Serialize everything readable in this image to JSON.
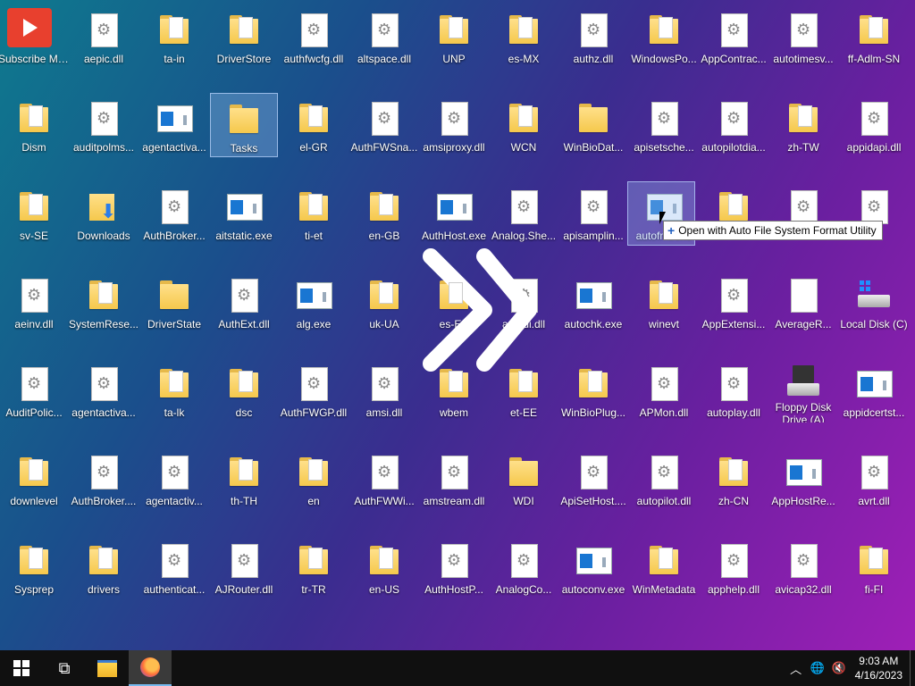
{
  "desktop": {
    "icons": [
      {
        "label": "Subscribe My Youtube Ch...",
        "type": "yt",
        "col": 0,
        "row": 0
      },
      {
        "label": "aepic.dll",
        "type": "file",
        "col": 1,
        "row": 0
      },
      {
        "label": "ta-in",
        "type": "folder docs",
        "col": 2,
        "row": 0
      },
      {
        "label": "DriverStore",
        "type": "folder docs",
        "col": 3,
        "row": 0
      },
      {
        "label": "authfwcfg.dll",
        "type": "file",
        "col": 4,
        "row": 0
      },
      {
        "label": "altspace.dll",
        "type": "file",
        "col": 5,
        "row": 0
      },
      {
        "label": "UNP",
        "type": "folder docs",
        "col": 6,
        "row": 0
      },
      {
        "label": "es-MX",
        "type": "folder docs",
        "col": 7,
        "row": 0
      },
      {
        "label": "authz.dll",
        "type": "file",
        "col": 8,
        "row": 0
      },
      {
        "label": "WindowsPo...",
        "type": "folder docs",
        "col": 9,
        "row": 0
      },
      {
        "label": "AppContrac...",
        "type": "file",
        "col": 10,
        "row": 0
      },
      {
        "label": "autotimesv...",
        "type": "file",
        "col": 11,
        "row": 0
      },
      {
        "label": "ff-Adlm-SN",
        "type": "folder docs",
        "col": 12,
        "row": 0
      },
      {
        "label": "Dism",
        "type": "folder docs",
        "col": 0,
        "row": 1
      },
      {
        "label": "auditpolms...",
        "type": "file",
        "col": 1,
        "row": 1
      },
      {
        "label": "agentactiva...",
        "type": "exe",
        "col": 2,
        "row": 1
      },
      {
        "label": "Tasks",
        "type": "folder",
        "col": 3,
        "row": 1,
        "selected": true
      },
      {
        "label": "el-GR",
        "type": "folder docs",
        "col": 4,
        "row": 1
      },
      {
        "label": "AuthFWSna...",
        "type": "file",
        "col": 5,
        "row": 1
      },
      {
        "label": "amsiproxy.dll",
        "type": "file",
        "col": 6,
        "row": 1
      },
      {
        "label": "WCN",
        "type": "folder docs",
        "col": 7,
        "row": 1
      },
      {
        "label": "WinBioDat...",
        "type": "folder",
        "col": 8,
        "row": 1
      },
      {
        "label": "apisetsche...",
        "type": "file",
        "col": 9,
        "row": 1
      },
      {
        "label": "autopilotdia...",
        "type": "file",
        "col": 10,
        "row": 1
      },
      {
        "label": "zh-TW",
        "type": "folder docs",
        "col": 11,
        "row": 1
      },
      {
        "label": "appidapi.dll",
        "type": "file",
        "col": 12,
        "row": 1
      },
      {
        "label": "sv-SE",
        "type": "folder docs",
        "col": 0,
        "row": 2
      },
      {
        "label": "Downloads",
        "type": "dl",
        "col": 1,
        "row": 2
      },
      {
        "label": "AuthBroker...",
        "type": "file",
        "col": 2,
        "row": 2
      },
      {
        "label": "aitstatic.exe",
        "type": "exe",
        "col": 3,
        "row": 2
      },
      {
        "label": "ti-et",
        "type": "folder docs",
        "col": 4,
        "row": 2
      },
      {
        "label": "en-GB",
        "type": "folder docs",
        "col": 5,
        "row": 2
      },
      {
        "label": "AuthHost.exe",
        "type": "exe",
        "col": 6,
        "row": 2
      },
      {
        "label": "Analog.She...",
        "type": "file",
        "col": 7,
        "row": 2
      },
      {
        "label": "apisamplin...",
        "type": "file",
        "col": 8,
        "row": 2
      },
      {
        "label": "autofmt.exe",
        "type": "exe",
        "col": 9,
        "row": 2
      },
      {
        "label": "",
        "type": "folder docs",
        "col": 10,
        "row": 2
      },
      {
        "label": "",
        "type": "file",
        "col": 11,
        "row": 2
      },
      {
        "label": "",
        "type": "file",
        "col": 12,
        "row": 2
      },
      {
        "label": "aeinv.dll",
        "type": "file",
        "col": 0,
        "row": 3
      },
      {
        "label": "SystemRese...",
        "type": "folder docs",
        "col": 1,
        "row": 3
      },
      {
        "label": "DriverState",
        "type": "folder",
        "col": 2,
        "row": 3
      },
      {
        "label": "AuthExt.dll",
        "type": "file",
        "col": 3,
        "row": 3
      },
      {
        "label": "alg.exe",
        "type": "exe",
        "col": 4,
        "row": 3
      },
      {
        "label": "uk-UA",
        "type": "folder docs",
        "col": 5,
        "row": 3
      },
      {
        "label": "es-ES",
        "type": "folder docs",
        "col": 6,
        "row": 3
      },
      {
        "label": "authui.dll",
        "type": "file",
        "col": 7,
        "row": 3
      },
      {
        "label": "autochk.exe",
        "type": "exe",
        "col": 8,
        "row": 3
      },
      {
        "label": "winevt",
        "type": "folder docs",
        "col": 9,
        "row": 3
      },
      {
        "label": "AppExtensi...",
        "type": "file",
        "col": 10,
        "row": 3
      },
      {
        "label": "AverageR...",
        "type": "file blank",
        "col": 11,
        "row": 3
      },
      {
        "label": "Local Disk (C)",
        "type": "disk",
        "col": 12,
        "row": 3
      },
      {
        "label": "AuditPolic...",
        "type": "file",
        "col": 0,
        "row": 4
      },
      {
        "label": "agentactiva...",
        "type": "file",
        "col": 1,
        "row": 4
      },
      {
        "label": "ta-lk",
        "type": "folder docs",
        "col": 2,
        "row": 4
      },
      {
        "label": "dsc",
        "type": "folder docs",
        "col": 3,
        "row": 4
      },
      {
        "label": "AuthFWGP.dll",
        "type": "file",
        "col": 4,
        "row": 4
      },
      {
        "label": "amsi.dll",
        "type": "file",
        "col": 5,
        "row": 4
      },
      {
        "label": "wbem",
        "type": "folder docs",
        "col": 6,
        "row": 4
      },
      {
        "label": "et-EE",
        "type": "folder docs",
        "col": 7,
        "row": 4
      },
      {
        "label": "WinBioPlug...",
        "type": "folder docs",
        "col": 8,
        "row": 4
      },
      {
        "label": "APMon.dll",
        "type": "file",
        "col": 9,
        "row": 4
      },
      {
        "label": "autoplay.dll",
        "type": "file",
        "col": 10,
        "row": 4
      },
      {
        "label": "Floppy Disk Drive (A)",
        "type": "floppy",
        "col": 11,
        "row": 4,
        "wrap": true
      },
      {
        "label": "appidcertst...",
        "type": "exe",
        "col": 12,
        "row": 4
      },
      {
        "label": "downlevel",
        "type": "folder docs",
        "col": 0,
        "row": 5
      },
      {
        "label": "AuthBroker....",
        "type": "file",
        "col": 1,
        "row": 5
      },
      {
        "label": "agentactiv...",
        "type": "file",
        "col": 2,
        "row": 5
      },
      {
        "label": "th-TH",
        "type": "folder docs",
        "col": 3,
        "row": 5
      },
      {
        "label": "en",
        "type": "folder docs",
        "col": 4,
        "row": 5
      },
      {
        "label": "AuthFWWi...",
        "type": "file",
        "col": 5,
        "row": 5
      },
      {
        "label": "amstream.dll",
        "type": "file",
        "col": 6,
        "row": 5
      },
      {
        "label": "WDI",
        "type": "folder",
        "col": 7,
        "row": 5
      },
      {
        "label": "ApiSetHost....",
        "type": "file",
        "col": 8,
        "row": 5
      },
      {
        "label": "autopilot.dll",
        "type": "file",
        "col": 9,
        "row": 5
      },
      {
        "label": "zh-CN",
        "type": "folder docs",
        "col": 10,
        "row": 5
      },
      {
        "label": "AppHostRe...",
        "type": "exe",
        "col": 11,
        "row": 5
      },
      {
        "label": "avrt.dll",
        "type": "file",
        "col": 12,
        "row": 5
      },
      {
        "label": "Sysprep",
        "type": "folder docs",
        "col": 0,
        "row": 6
      },
      {
        "label": "drivers",
        "type": "folder docs",
        "col": 1,
        "row": 6
      },
      {
        "label": "authenticat...",
        "type": "file",
        "col": 2,
        "row": 6
      },
      {
        "label": "AJRouter.dll",
        "type": "file",
        "col": 3,
        "row": 6
      },
      {
        "label": "tr-TR",
        "type": "folder docs",
        "col": 4,
        "row": 6
      },
      {
        "label": "en-US",
        "type": "folder docs",
        "col": 5,
        "row": 6
      },
      {
        "label": "AuthHostP...",
        "type": "file",
        "col": 6,
        "row": 6
      },
      {
        "label": "AnalogCo...",
        "type": "file",
        "col": 7,
        "row": 6
      },
      {
        "label": "autoconv.exe",
        "type": "exe",
        "col": 8,
        "row": 6
      },
      {
        "label": "WinMetadata",
        "type": "folder docs",
        "col": 9,
        "row": 6
      },
      {
        "label": "apphelp.dll",
        "type": "file",
        "col": 10,
        "row": 6
      },
      {
        "label": "avicap32.dll",
        "type": "file",
        "col": 11,
        "row": 6
      },
      {
        "label": "fi-FI",
        "type": "folder docs",
        "col": 12,
        "row": 6
      }
    ]
  },
  "drag": {
    "tooltip": "Open with Auto File System Format Utility",
    "dragged_item": "Tasks"
  },
  "taskbar": {
    "start_icon": "windows-logo-icon",
    "taskview_icon": "task-view-icon",
    "explorer_icon": "file-explorer-icon",
    "firefox_icon": "firefox-icon",
    "tray": {
      "chevron": "^",
      "time": "9:03 AM",
      "date": "4/16/2023"
    }
  },
  "colors": {
    "accent": "#76b9ed",
    "taskbar": "#101010"
  }
}
